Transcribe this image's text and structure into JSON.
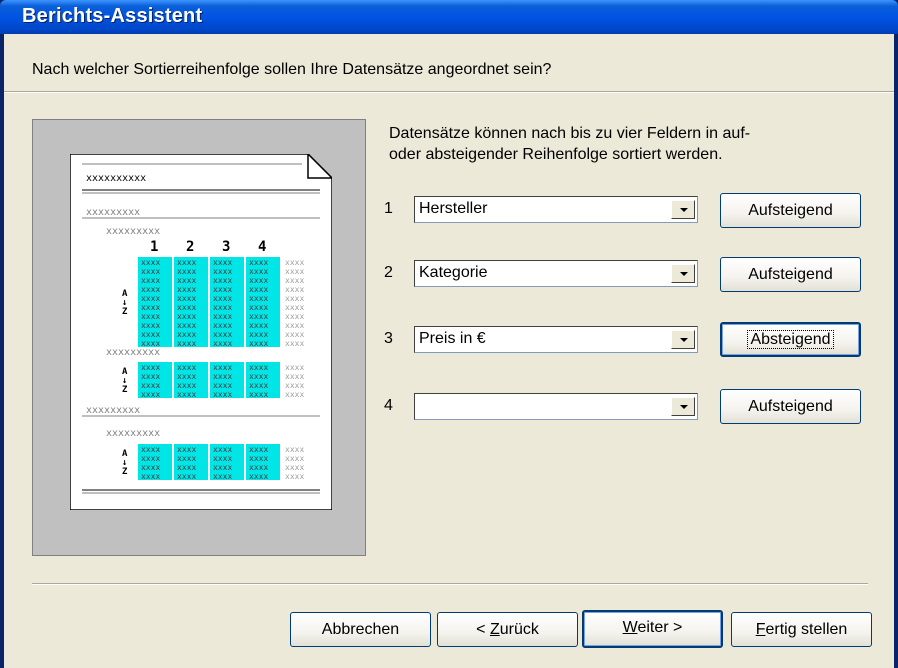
{
  "window": {
    "title": "Berichts-Assistent"
  },
  "question": "Nach welcher Sortierreihenfolge sollen Ihre Datensätze angeordnet sein?",
  "description_line1": "Datensätze können nach bis zu vier Feldern in auf-",
  "description_line2": "oder absteigender Reihenfolge sortiert werden.",
  "preview": {
    "placeholder": "xxxxxxxxxx",
    "placeholder_short": "xxxxxxxxx",
    "cell": "xxxx",
    "columns": [
      "1",
      "2",
      "3",
      "4"
    ],
    "sort_top": "A",
    "sort_bottom": "Z",
    "sort_arrow": "↓"
  },
  "sort_rows": [
    {
      "number": "1",
      "field": "Hersteller",
      "order": "Aufsteigend"
    },
    {
      "number": "2",
      "field": "Kategorie",
      "order": "Aufsteigend"
    },
    {
      "number": "3",
      "field": "Preis in €",
      "order": "Absteigend"
    },
    {
      "number": "4",
      "field": "",
      "order": "Aufsteigend"
    }
  ],
  "buttons": {
    "cancel": "Abbrechen",
    "back_prefix": "< ",
    "back_accel": "Z",
    "back_rest": "urück",
    "next_accel": "W",
    "next_rest": "eiter >",
    "finish_accel": "F",
    "finish_rest": "ertig stellen"
  },
  "colors": {
    "titlebar": "#0054e3",
    "dialog_bg": "#ece9d8",
    "preview_highlight": "#00e5e5"
  }
}
